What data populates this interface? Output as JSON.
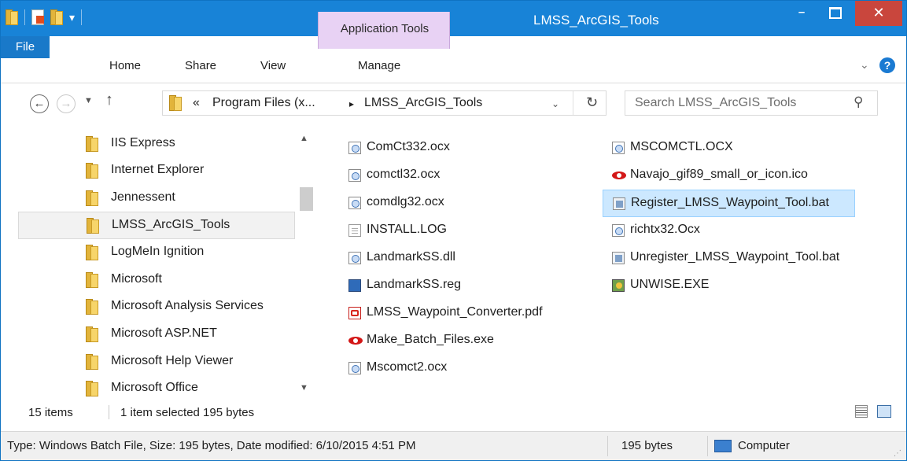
{
  "window": {
    "title": "LMSS_ArcGIS_Tools",
    "context_tab": "Application Tools",
    "close_label": "✕",
    "minimize_label": "–"
  },
  "ribbon": {
    "tabs": [
      "File",
      "Home",
      "Share",
      "View",
      "Manage"
    ],
    "help_label": "?",
    "expand_label": "⌄"
  },
  "address": {
    "crumbs": [
      "«",
      "Program Files (x...",
      "▸",
      "LMSS_ArcGIS_Tools"
    ],
    "dropdown_label": "⌄",
    "refresh_label": "↻"
  },
  "search": {
    "placeholder": "Search LMSS_ArcGIS_Tools",
    "icon": "search-icon"
  },
  "nav_pane": {
    "items": [
      {
        "label": "IIS Express"
      },
      {
        "label": "Internet Explorer"
      },
      {
        "label": "Jennessent"
      },
      {
        "label": "LMSS_ArcGIS_Tools",
        "selected": true
      },
      {
        "label": "LogMeIn Ignition"
      },
      {
        "label": "Microsoft"
      },
      {
        "label": "Microsoft Analysis Services"
      },
      {
        "label": "Microsoft ASP.NET"
      },
      {
        "label": "Microsoft Help Viewer"
      },
      {
        "label": "Microsoft Office"
      }
    ]
  },
  "files": {
    "column1": [
      {
        "name": "ComCt332.ocx",
        "type": "ocx"
      },
      {
        "name": "comctl32.ocx",
        "type": "ocx"
      },
      {
        "name": "comdlg32.ocx",
        "type": "ocx"
      },
      {
        "name": "INSTALL.LOG",
        "type": "log"
      },
      {
        "name": "LandmarkSS.dll",
        "type": "ocx"
      },
      {
        "name": "LandmarkSS.reg",
        "type": "reg"
      },
      {
        "name": "LMSS_Waypoint_Converter.pdf",
        "type": "pdf"
      },
      {
        "name": "Make_Batch_Files.exe",
        "type": "exe"
      },
      {
        "name": "Mscomct2.ocx",
        "type": "ocx"
      }
    ],
    "column2": [
      {
        "name": "MSCOMCTL.OCX",
        "type": "ocx"
      },
      {
        "name": "Navajo_gif89_small_or_icon.ico",
        "type": "exe"
      },
      {
        "name": "Register_LMSS_Waypoint_Tool.bat",
        "type": "bat",
        "selected": true
      },
      {
        "name": "richtx32.Ocx",
        "type": "ocx"
      },
      {
        "name": "Unregister_LMSS_Waypoint_Tool.bat",
        "type": "bat"
      },
      {
        "name": "UNWISE.EXE",
        "type": "setup"
      }
    ]
  },
  "count_bar": {
    "items": "15 items",
    "selection": "1 item selected  195 bytes"
  },
  "status_bar": {
    "details": "Type: Windows Batch File, Size: 195 bytes, Date modified: 6/10/2015 4:51 PM",
    "size": "195 bytes",
    "location": "Computer"
  },
  "colors": {
    "titlebar": "#1883d7",
    "close": "#c9463d",
    "context_tab": "#e8d2f4",
    "selection": "#cce8ff"
  }
}
